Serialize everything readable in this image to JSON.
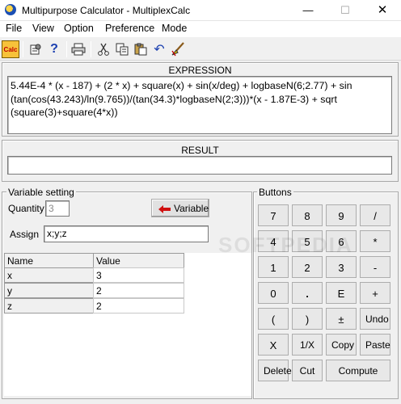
{
  "window": {
    "title": "Multipurpose Calculator - MultiplexCalc",
    "minimize": "—",
    "maximize": "☐",
    "close": "✕"
  },
  "menu": [
    "File",
    "View",
    "Option",
    "Preference",
    "Mode"
  ],
  "toolbar": {
    "calc_label": "Calc"
  },
  "expression": {
    "label": "EXPRESSION",
    "text": "5.44E-4 * (x - 187) + (2 * x) + square(x) + sin(x/deg) + logbaseN(6;2.77) + sin (tan(cos(43.243)/ln(9.765))/(tan(34.3)*logbaseN(2;3)))*(x - 1.87E-3) + sqrt (square(3)+square(4*x))"
  },
  "result": {
    "label": "RESULT",
    "value": ""
  },
  "variables": {
    "group_label": "Variable setting",
    "quantity_label": "Quantity",
    "quantity_value": "3",
    "variable_button": "Variable",
    "assign_label": "Assign",
    "assign_value": "x;y;z",
    "columns": [
      "Name",
      "Value"
    ],
    "rows": [
      {
        "name": "x",
        "value": "3"
      },
      {
        "name": "y",
        "value": "2"
      },
      {
        "name": "z",
        "value": "2"
      }
    ]
  },
  "buttons": {
    "group_label": "Buttons",
    "rows": [
      [
        "7",
        "8",
        "9",
        "/"
      ],
      [
        "4",
        "5",
        "6",
        "*"
      ],
      [
        "1",
        "2",
        "3",
        "-"
      ],
      [
        "0",
        ".",
        "E",
        "+"
      ],
      [
        "(",
        ")",
        "±",
        "Undo"
      ],
      [
        "X",
        "1/X",
        "Copy",
        "Paste"
      ]
    ],
    "bottom": [
      "Delete",
      "Cut",
      "Compute"
    ]
  },
  "watermark": "SOFTPEDIA"
}
